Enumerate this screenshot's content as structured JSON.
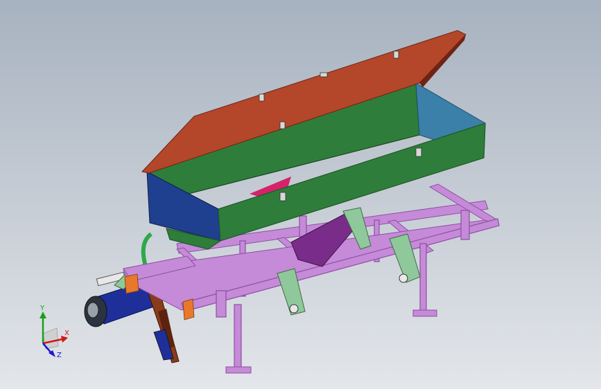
{
  "viewport": {
    "background_top": "#a7b2c0",
    "background_bottom": "#e3e6ea"
  },
  "model": {
    "colors": {
      "lid": "#b4462a",
      "lid_edge": "#6e2414",
      "hopper_green": "#2f7d3a",
      "hopper_green_dark": "#1f5a28",
      "hopper_end_blue": "#1f3f8f",
      "hopper_end_light": "#3b80a8",
      "divider_pink": "#d6226a",
      "frame_pink": "#c58ad8",
      "frame_pink_dark": "#8d4fa0",
      "bracket_purple": "#7a2c8a",
      "bracket_green": "#8fc89a",
      "roller_blue": "#1f2f9a",
      "shank_brown": "#8a3b1a",
      "orange_accent": "#e8782a"
    }
  },
  "triad": {
    "labels": {
      "y": "Y",
      "x": "X",
      "z": "Z"
    },
    "colors": {
      "y": "#18a018",
      "x": "#d01818",
      "z": "#1818d0"
    }
  }
}
